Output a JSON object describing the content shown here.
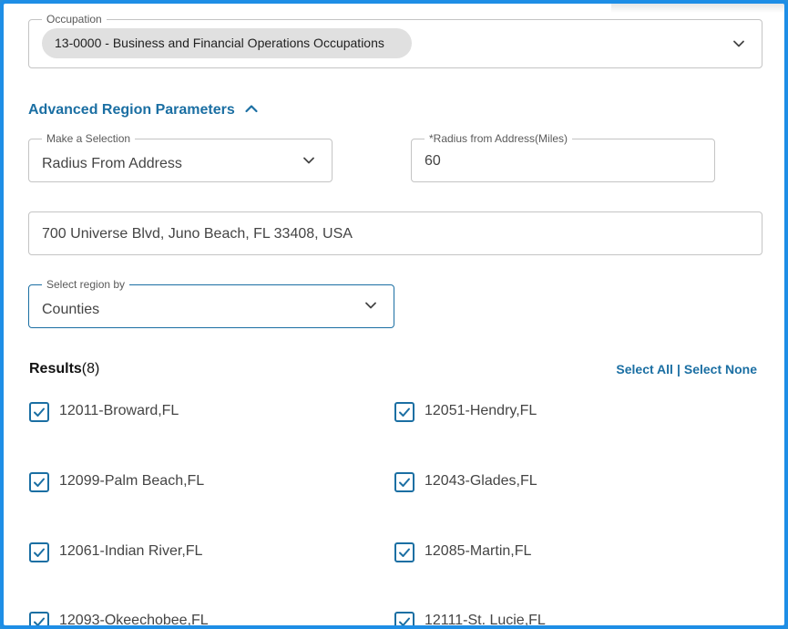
{
  "occupation": {
    "legend": "Occupation",
    "chip": "13-0000 - Business and Financial Operations Occupations"
  },
  "advanced": {
    "label": "Advanced Region Parameters"
  },
  "selection": {
    "legend": "Make a Selection",
    "value": "Radius From Address"
  },
  "radius": {
    "legend": "*Radius from Address(Miles)",
    "value": "60"
  },
  "address": {
    "value": "700 Universe Blvd, Juno Beach, FL 33408, USA"
  },
  "region": {
    "legend": "Select region by",
    "value": "Counties"
  },
  "results": {
    "title": "Results",
    "count": "(8)",
    "select_all": "Select All",
    "separator": "|",
    "select_none": "Select None",
    "items": [
      {
        "label": "12011-Broward,FL",
        "checked": true
      },
      {
        "label": "12051-Hendry,FL",
        "checked": true
      },
      {
        "label": "12099-Palm Beach,FL",
        "checked": true
      },
      {
        "label": "12043-Glades,FL",
        "checked": true
      },
      {
        "label": "12061-Indian River,FL",
        "checked": true
      },
      {
        "label": "12085-Martin,FL",
        "checked": true
      },
      {
        "label": "12093-Okeechobee,FL",
        "checked": true
      },
      {
        "label": "12111-St. Lucie,FL",
        "checked": true
      }
    ]
  },
  "colors": {
    "accent": "#1b6fa3",
    "frame": "#1e8ee6",
    "chip_bg": "#e0e0e0"
  },
  "icons": {
    "dropdown": "chevron-down-icon",
    "collapse": "chevron-up-icon",
    "checkbox": "checkbox-checked-icon"
  }
}
